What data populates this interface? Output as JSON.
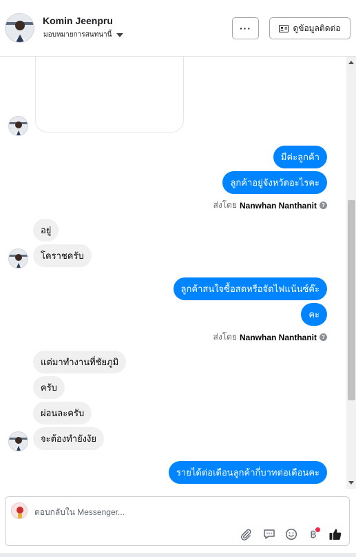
{
  "header": {
    "customer_name": "Komin Jeenpru",
    "assign_label": "มอบหมายการสนทนานี้",
    "more_label": "···",
    "contact_label": "ดูข้อมูลติดต่อ"
  },
  "messages": {
    "out_1": "มีค่ะลูกค้า",
    "out_2": "ลูกค้าอยู่จังหวัดอะไรคะ",
    "in_1": "อยู่",
    "in_2": "โคราชครับ",
    "out_3": "ลูกค้าสนใจซื้อสดหรือจัดไฟแน้นซ์ค๊ะ",
    "out_4": "คะ",
    "in_3": "แต่มาทำงานที่ชัยภูมิ",
    "in_4": "ครับ",
    "in_5": "ผ่อนละครับ",
    "in_6": "จะต้องทำยังงัย",
    "out_5": "รายได้ต่อเดือนลูกค้ากี่บาทต่อเดือนคะ"
  },
  "sent_by": {
    "prefix": "ส่งโดย",
    "agent_1": "Nanwhan Nanthanit",
    "agent_2": "Nanwhan Nanthanit"
  },
  "composer": {
    "placeholder": "ตอบกลับใน Messenger..."
  },
  "icons": {
    "more": "ellipsis-icon",
    "contact": "contact-card-icon",
    "attach": "paperclip-icon",
    "saved_replies": "chat-bubble-icon",
    "emoji": "smiley-icon",
    "payment": "baht-icon",
    "like": "thumbs-up-icon"
  },
  "colors": {
    "outgoing_bubble": "#0084ff",
    "incoming_bubble": "#f0f0f0",
    "notification_dot": "#f02849"
  }
}
